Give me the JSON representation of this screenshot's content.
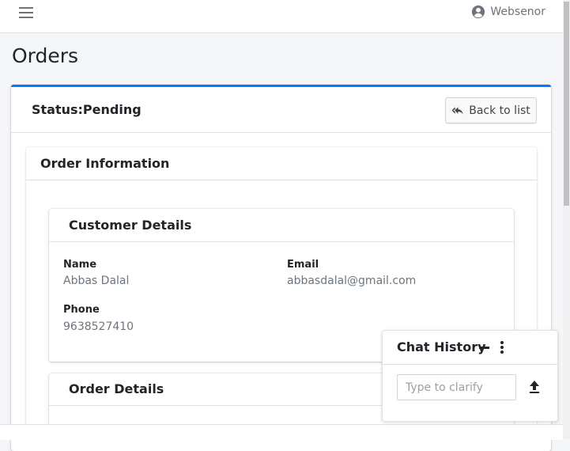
{
  "navbar": {
    "user_name": "Websenor"
  },
  "page": {
    "title": "Orders"
  },
  "order": {
    "status_label": "Status:Pending",
    "back_button": "Back to list",
    "info_title": "Order Information"
  },
  "customer": {
    "title": "Customer Details",
    "name_label": "Name",
    "name_value": "Abbas Dalal",
    "email_label": "Email",
    "email_value": "abbasdalal@gmail.com",
    "phone_label": "Phone",
    "phone_value": "9638527410"
  },
  "order_details": {
    "title": "Order Details"
  },
  "chat": {
    "title": "Chat History",
    "input_placeholder": "Type to clarify"
  },
  "colors": {
    "accent": "#007bff",
    "background": "#f4f6f9"
  },
  "icons": [
    "hamburger-menu-icon",
    "user-circle-icon",
    "reply-all-icon",
    "minimize-icon",
    "more-vertical-icon",
    "upload-icon"
  ]
}
